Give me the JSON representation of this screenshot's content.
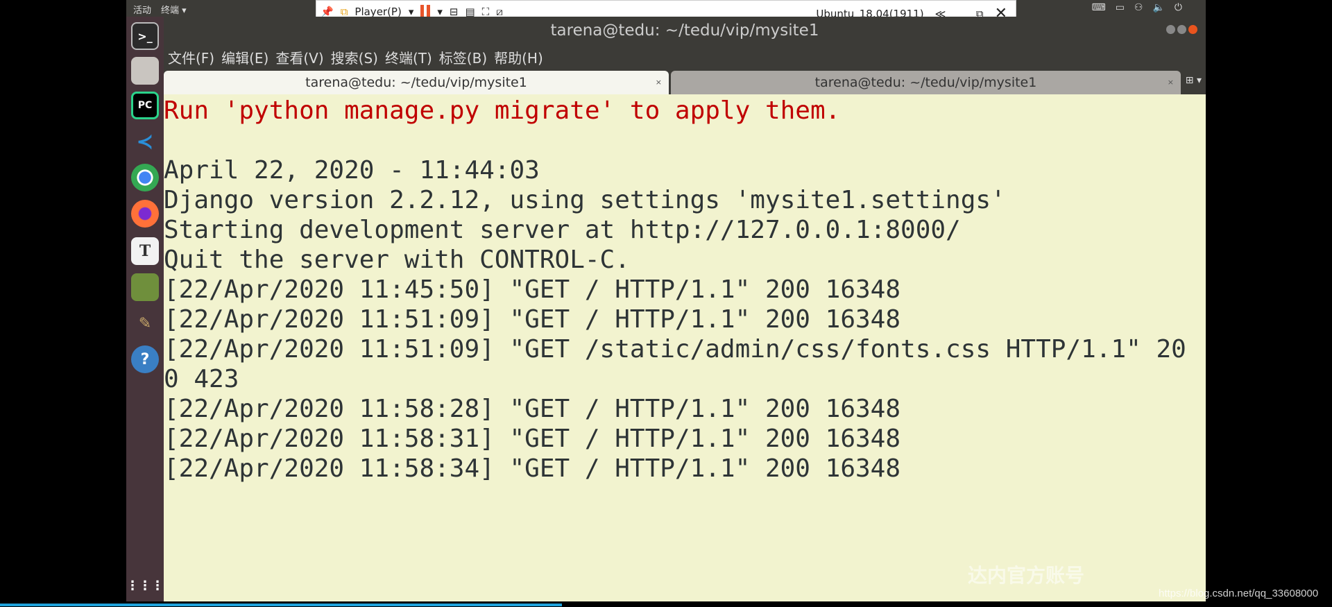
{
  "topbar": {
    "activities": "活动",
    "app": "终端 ▾",
    "tray_icons": [
      "keyboard-icon",
      "display-icon",
      "network-icon",
      "volume-icon",
      "power-icon"
    ]
  },
  "vmware": {
    "player_label": "Player(P)",
    "vm_name": "Ubuntu_18.04(1911)",
    "collapse": "≪"
  },
  "window": {
    "title": "tarena@tedu: ~/tedu/vip/mysite1"
  },
  "menu": [
    "文件(F)",
    "编辑(E)",
    "查看(V)",
    "搜索(S)",
    "终端(T)",
    "标签(B)",
    "帮助(H)"
  ],
  "tabs": [
    {
      "label": "tarena@tedu: ~/tedu/vip/mysite1",
      "active": true
    },
    {
      "label": "tarena@tedu: ~/tedu/vip/mysite1",
      "active": false
    }
  ],
  "dock": [
    "terminal",
    "files",
    "pycharm",
    "vscode",
    "chrome",
    "firefox",
    "typora",
    "library",
    "paint",
    "help"
  ],
  "terminal": {
    "warning": "Run 'python manage.py migrate' to apply them.",
    "lines": [
      "",
      "April 22, 2020 - 11:44:03",
      "Django version 2.2.12, using settings 'mysite1.settings'",
      "Starting development server at http://127.0.0.1:8000/",
      "Quit the server with CONTROL-C.",
      "[22/Apr/2020 11:45:50] \"GET / HTTP/1.1\" 200 16348",
      "[22/Apr/2020 11:51:09] \"GET / HTTP/1.1\" 200 16348",
      "[22/Apr/2020 11:51:09] \"GET /static/admin/css/fonts.css HTTP/1.1\" 20",
      "0 423",
      "[22/Apr/2020 11:58:28] \"GET / HTTP/1.1\" 200 16348",
      "[22/Apr/2020 11:58:31] \"GET / HTTP/1.1\" 200 16348",
      "[22/Apr/2020 11:58:34] \"GET / HTTP/1.1\" 200 16348"
    ]
  },
  "watermark": {
    "text": "达内官方账号",
    "url": "https://blog.csdn.net/qq_33608000"
  },
  "colors": {
    "terminal_bg": "#f2f3cf",
    "warning": "#c00000",
    "dock": "#47353b",
    "progress": "#1fa3dc"
  }
}
